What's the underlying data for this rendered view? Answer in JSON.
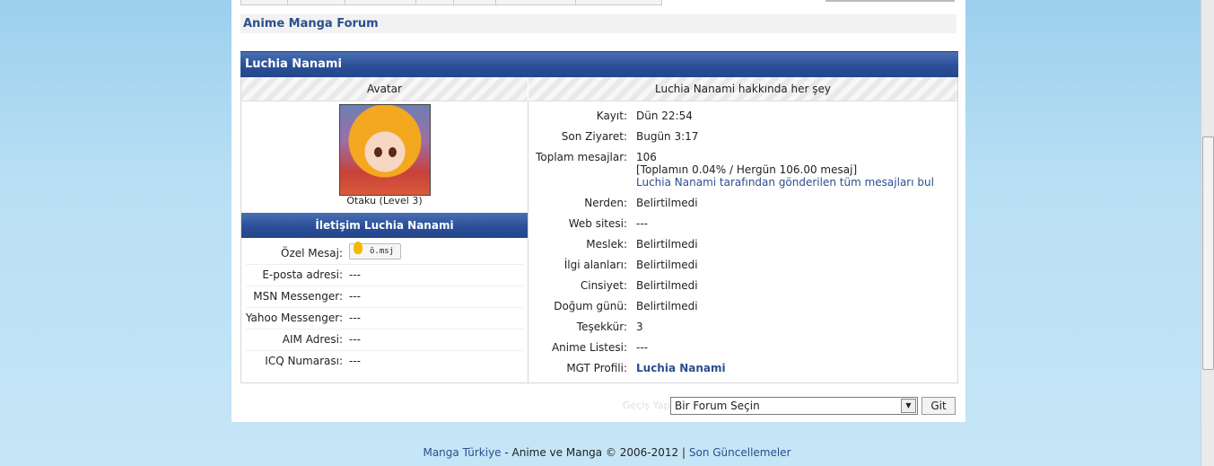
{
  "navbar": {
    "forum_title": "Anime Manga Forum"
  },
  "profile": {
    "name_title": "Luchia Nanami",
    "avatar_header": "Avatar",
    "about_header": "Luchia Nanami hakkında her şey",
    "avatar_caption": "Otaku (Level 3)"
  },
  "contact": {
    "header": "İletişim Luchia Nanami",
    "rows": [
      {
        "label": "Özel Mesaj:",
        "value": ""
      },
      {
        "label": "E-posta adresi:",
        "value": "---"
      },
      {
        "label": "MSN Messenger:",
        "value": "---"
      },
      {
        "label": "Yahoo Messenger:",
        "value": "---"
      },
      {
        "label": "AIM Adresi:",
        "value": "---"
      },
      {
        "label": "ICQ Numarası:",
        "value": "---"
      }
    ],
    "pm_button_label": "ö.msj"
  },
  "info": {
    "registered_label": "Kayıt:",
    "registered_value": "Dün 22:54",
    "last_visit_label": "Son Ziyaret:",
    "last_visit_value": "Bugün 3:17",
    "total_posts_label": "Toplam mesajlar:",
    "total_posts_value": "106",
    "posts_stats": "[Toplamın 0.04% / Hergün 106.00 mesaj]",
    "find_posts_link": "Luchia Nanami tarafından gönderilen tüm mesajları bul",
    "location_label": "Nerden:",
    "location_value": "Belirtilmedi",
    "website_label": "Web sitesi:",
    "website_value": "---",
    "occupation_label": "Meslek:",
    "occupation_value": "Belirtilmedi",
    "interests_label": "İlgi alanları:",
    "interests_value": "Belirtilmedi",
    "gender_label": "Cinsiyet:",
    "gender_value": "Belirtilmedi",
    "birthday_label": "Doğum günü:",
    "birthday_value": "Belirtilmedi",
    "thanks_label": "Teşekkür:",
    "thanks_value": "3",
    "anime_list_label": "Anime Listesi:",
    "anime_list_value": "---",
    "mgt_profile_label": "MGT Profili:",
    "mgt_profile_value": "Luchia Nanami"
  },
  "jump": {
    "label": "Geçiş Yap:",
    "selected": "Bir Forum Seçin",
    "go_button": "Git"
  },
  "footer": {
    "site_link": "Manga Türkiye",
    "middle_text": " - Anime ve Manga © 2006-2012 | ",
    "recent_link": "Son Güncellemeler"
  }
}
